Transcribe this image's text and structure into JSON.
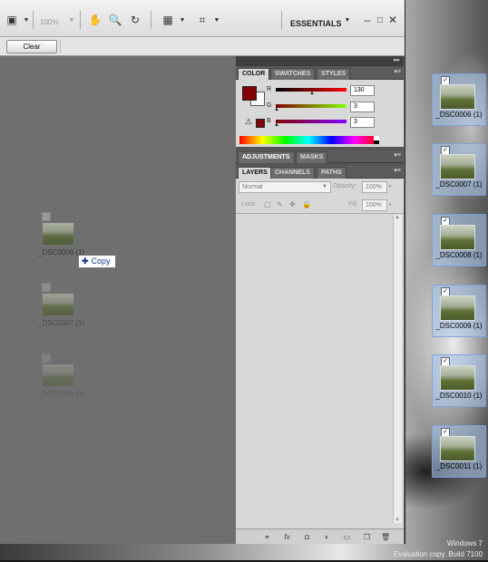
{
  "app": {
    "zoom": "100%",
    "workspace": "ESSENTIALS",
    "clear_label": "Clear"
  },
  "canvas": {
    "ghost_items": [
      {
        "label": "_DSC0006 (1)"
      },
      {
        "label": "_DSC0007 (1)"
      },
      {
        "label": "_DSC0008 (1)"
      }
    ],
    "drag_tooltip": "Copy"
  },
  "color_panel": {
    "tabs": [
      "COLOR",
      "SWATCHES",
      "STYLES"
    ],
    "channels": [
      {
        "label": "R",
        "value": "130"
      },
      {
        "label": "G",
        "value": "3"
      },
      {
        "label": "B",
        "value": "3"
      }
    ],
    "foreground_color": "#820303"
  },
  "adjust_panel": {
    "tabs": [
      "ADJUSTMENTS",
      "MASKS"
    ]
  },
  "layers_panel": {
    "tabs": [
      "LAYERS",
      "CHANNELS",
      "PATHS"
    ],
    "blend_mode": "Normal",
    "opacity_label": "Opacity:",
    "opacity_value": "100%",
    "lock_label": "Lock:",
    "fill_label": "Fill:",
    "fill_value": "100%"
  },
  "desktop_icons": [
    {
      "label": "_DSC0006 (1)"
    },
    {
      "label": "_DSC0007 (1)"
    },
    {
      "label": "_DSC0008 (1)"
    },
    {
      "label": "_DSC0009 (1)"
    },
    {
      "label": "_DSC0010 (1)"
    },
    {
      "label": "_DSC0011 (1)"
    }
  ],
  "watermark": {
    "line1": "Windows 7",
    "line2": "Evaluation copy. Build 7100"
  }
}
